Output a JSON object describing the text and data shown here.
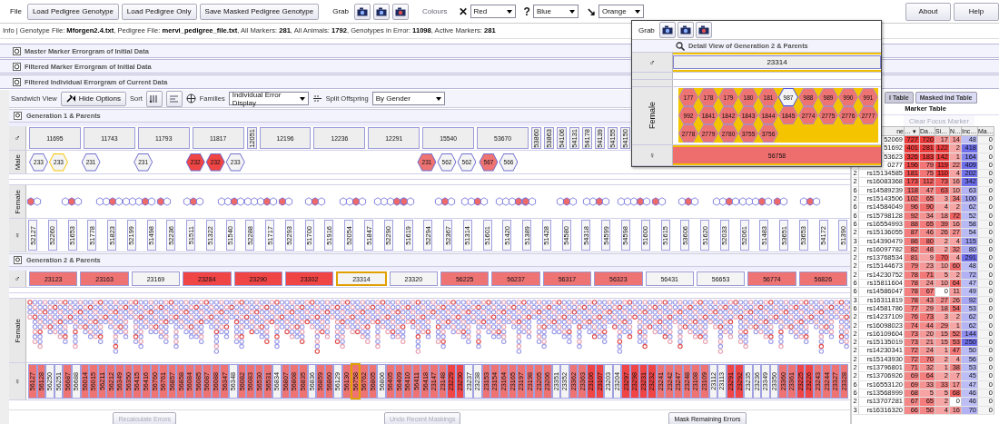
{
  "toolbar": {
    "file_label": "File",
    "buttons": [
      "Load Pedigree Genotype",
      "Load Pedigree Only",
      "Save Masked Pedigree Genotype"
    ],
    "grab_label": "Grab",
    "colours_label": "Colours",
    "colour_selects": [
      {
        "symbol": "✕",
        "value": "Red"
      },
      {
        "symbol": "?",
        "value": "Blue"
      },
      {
        "symbol": "↘",
        "value": "Orange"
      }
    ],
    "right_buttons": [
      "About",
      "Help"
    ]
  },
  "info": "Info | Genotype File: **Mforgen2.4.txt**, Pedigree File: **mervi_pedigree_file.txt**, All Markers: **281**, All Animals: **1792**, Genotypes in Error: **11098**, Active Markers: **281**",
  "sections": [
    "Master Marker Errorgram of Initial Data",
    "Filtered Marker Errorgram of Initial Data",
    "Filtered Individual Errorgram of Current Data"
  ],
  "options": {
    "label": "Sandwich View",
    "hide_button": "Hide Options",
    "sort_label": "Sort",
    "families_label": "Families",
    "families_value": "Individual Error Display",
    "split_label": "Split Offspring",
    "split_value": "By Gender"
  },
  "generation1": {
    "title": "Generation 1 & Parents",
    "father_symbol": "♂",
    "male_label": "Male",
    "female_label": "Female",
    "mother_symbol": "♀",
    "fathers": [
      {
        "label": "11695",
        "kind": "wide",
        "sons": [
          {
            "label": "233",
            "color": "#f4f4f4",
            "selected": false
          },
          {
            "label": "233",
            "color": "#f4f4f4",
            "selected": true
          }
        ]
      },
      {
        "label": "11743",
        "kind": "wide",
        "sons": [
          {
            "label": "231",
            "color": "#f4f4f4",
            "selected": false
          }
        ]
      },
      {
        "label": "11793",
        "kind": "wide",
        "sons": [
          {
            "label": "231",
            "color": "#f4f4f4",
            "selected": false
          }
        ]
      },
      {
        "label": "11817",
        "kind": "wide",
        "sons": [
          {
            "label": "232",
            "color": "#f04545",
            "selected": false
          },
          {
            "label": "232",
            "color": "#f04545",
            "selected": false
          },
          {
            "label": "233",
            "color": "#f4f4f4",
            "selected": false
          }
        ]
      },
      {
        "label": "12051",
        "kind": "narrow"
      },
      {
        "label": "12196",
        "kind": "wide"
      },
      {
        "label": "12236",
        "kind": "wide"
      },
      {
        "label": "12291",
        "kind": "wide"
      },
      {
        "label": "15540",
        "kind": "wide",
        "sons": [
          {
            "label": "231",
            "color": "#ee7373",
            "selected": false
          },
          {
            "label": "562",
            "color": "#f4f4f4",
            "selected": false
          },
          {
            "label": "562",
            "color": "#f4f4f4",
            "selected": false
          }
        ]
      },
      {
        "label": "53670",
        "kind": "wide",
        "sons": [
          {
            "label": "567",
            "color": "#ee7373",
            "selected": false
          },
          {
            "label": "566",
            "color": "#f4f4f4",
            "selected": false
          }
        ]
      },
      {
        "label": "53860",
        "kind": "narrow"
      },
      {
        "label": "53863",
        "kind": "narrow"
      },
      {
        "label": "54106",
        "kind": "narrow"
      },
      {
        "label": "54131",
        "kind": "narrow"
      },
      {
        "label": "54178",
        "kind": "narrow"
      },
      {
        "label": "54139",
        "kind": "narrow"
      },
      {
        "label": "54155",
        "kind": "narrow"
      },
      {
        "label": "54150",
        "kind": "narrow"
      }
    ],
    "offspring": [
      "52127",
      "52260",
      "51653",
      "51778",
      "51823",
      "52199",
      "51498",
      "52236",
      "51511",
      "51322",
      "51540",
      "52288",
      "51717",
      "52293",
      "51700",
      "51916",
      "52054",
      "51847",
      "52290",
      "51619",
      "52294",
      "52367",
      "51314",
      "51601",
      "51420",
      "51389",
      "51428",
      "54580",
      "54318",
      "54599",
      "54598",
      "51600",
      "51615",
      "53606",
      "51620",
      "52033",
      "52061",
      "51483",
      "53651",
      "53653",
      "54172",
      "51390"
    ]
  },
  "generation2": {
    "title": "Generation 2 & Parents",
    "father_symbol": "♂",
    "female_label": "Female",
    "mother_symbol": "♀",
    "fathers": [
      {
        "label": "23123",
        "color": "#ee7373",
        "selected": false
      },
      {
        "label": "23163",
        "color": "#ee7373",
        "selected": false
      },
      {
        "label": "23169",
        "color": "#f4f4f4",
        "selected": false
      },
      {
        "label": "23284",
        "color": "#f04545",
        "selected": false
      },
      {
        "label": "23290",
        "color": "#f04545",
        "selected": false
      },
      {
        "label": "23302",
        "color": "#f04545",
        "selected": false
      },
      {
        "label": "23314",
        "color": "#f4f4f4",
        "selected": true
      },
      {
        "label": "23320",
        "color": "#f4f4f4",
        "selected": false
      },
      {
        "label": "56225",
        "color": "#ee7373",
        "selected": false
      },
      {
        "label": "56237",
        "color": "#ee7373",
        "selected": false
      },
      {
        "label": "56317",
        "color": "#ee7373",
        "selected": false
      },
      {
        "label": "56323",
        "color": "#ee7373",
        "selected": false
      },
      {
        "label": "56431",
        "color": "#f4f4f4",
        "selected": false
      },
      {
        "label": "56653",
        "color": "#f4f4f4",
        "selected": false
      },
      {
        "label": "56774",
        "color": "#ee7373",
        "selected": false
      },
      {
        "label": "56826",
        "color": "#ee7373",
        "selected": false
      }
    ],
    "offspring": [
      {
        "label": "56127",
        "color": "#ee7373",
        "selected": false
      },
      {
        "label": "56128",
        "color": "#ee7373",
        "selected": false
      },
      {
        "label": "56250",
        "color": "#f4f4f4",
        "selected": false
      },
      {
        "label": "56251",
        "color": "#f4f4f4",
        "selected": false
      },
      {
        "label": "56687",
        "color": "#ee7373",
        "selected": false
      },
      {
        "label": "56688",
        "color": "#f4f4f4",
        "selected": false
      },
      {
        "label": "56014",
        "color": "#ee7373",
        "selected": false
      },
      {
        "label": "56015",
        "color": "#ee7373",
        "selected": false
      },
      {
        "label": "56211",
        "color": "#ee7373",
        "selected": false
      },
      {
        "label": "56212",
        "color": "#ee7373",
        "selected": false
      },
      {
        "label": "56349",
        "color": "#ee7373",
        "selected": false
      },
      {
        "label": "56350",
        "color": "#ee7373",
        "selected": false
      },
      {
        "label": "56415",
        "color": "#ee7373",
        "selected": false
      },
      {
        "label": "56416",
        "color": "#ee7373",
        "selected": false
      },
      {
        "label": "56760",
        "color": "#ee7373",
        "selected": false
      },
      {
        "label": "56761",
        "color": "#ee7373",
        "selected": false
      },
      {
        "label": "56857",
        "color": "#ee7373",
        "selected": false
      },
      {
        "label": "56858",
        "color": "#ee7373",
        "selected": false
      },
      {
        "label": "56084",
        "color": "#ee7373",
        "selected": false
      },
      {
        "label": "56085",
        "color": "#ee7373",
        "selected": false
      },
      {
        "label": "56087",
        "color": "#ee7373",
        "selected": false
      },
      {
        "label": "56088",
        "color": "#ee7373",
        "selected": false
      },
      {
        "label": "56347",
        "color": "#ee7373",
        "selected": false
      },
      {
        "label": "56348",
        "color": "#f4f4f4",
        "selected": false
      },
      {
        "label": "56082",
        "color": "#ee7373",
        "selected": false
      },
      {
        "label": "56083",
        "color": "#ee7373",
        "selected": false
      },
      {
        "label": "56530",
        "color": "#ee7373",
        "selected": false
      },
      {
        "label": "56531",
        "color": "#ee7373",
        "selected": false
      },
      {
        "label": "56834",
        "color": "#f4f4f4",
        "selected": false
      },
      {
        "label": "56807",
        "color": "#ee7373",
        "selected": false
      },
      {
        "label": "56808",
        "color": "#ee7373",
        "selected": false
      },
      {
        "label": "56835",
        "color": "#ee7373",
        "selected": false
      },
      {
        "label": "56836",
        "color": "#f4f4f4",
        "selected": false
      },
      {
        "label": "56859",
        "color": "#ee7373",
        "selected": false
      },
      {
        "label": "56860",
        "color": "#ee7373",
        "selected": false
      },
      {
        "label": "56129",
        "color": "#f4f4f4",
        "selected": false
      },
      {
        "label": "56130",
        "color": "#ee7373",
        "selected": false
      },
      {
        "label": "56758",
        "color": "#ee7373",
        "selected": true
      },
      {
        "label": "56762",
        "color": "#ee7373",
        "selected": false
      },
      {
        "label": "56805",
        "color": "#ee7373",
        "selected": false
      },
      {
        "label": "56806",
        "color": "#f4f4f4",
        "selected": false
      },
      {
        "label": "56405",
        "color": "#ee7373",
        "selected": false
      },
      {
        "label": "56409",
        "color": "#ee7373",
        "selected": false
      },
      {
        "label": "56410",
        "color": "#ee7373",
        "selected": false
      },
      {
        "label": "56411",
        "color": "#ee7373",
        "selected": false
      },
      {
        "label": "56418",
        "color": "#ee7373",
        "selected": false
      },
      {
        "label": "23147",
        "color": "#ee7373",
        "selected": false
      },
      {
        "label": "23148",
        "color": "#ee7373",
        "selected": false
      },
      {
        "label": "23229",
        "color": "#f04545",
        "selected": false
      },
      {
        "label": "23230",
        "color": "#f04545",
        "selected": false
      },
      {
        "label": "23237",
        "color": "#f4f4f4",
        "selected": false
      },
      {
        "label": "23238",
        "color": "#f4f4f4",
        "selected": false
      },
      {
        "label": "23153",
        "color": "#ee7373",
        "selected": false
      },
      {
        "label": "23154",
        "color": "#ee7373",
        "selected": false
      },
      {
        "label": "23164",
        "color": "#ee7373",
        "selected": false
      },
      {
        "label": "23165",
        "color": "#ee7373",
        "selected": false
      },
      {
        "label": "23197",
        "color": "#ee7373",
        "selected": false
      },
      {
        "label": "23198",
        "color": "#ee7373",
        "selected": false
      },
      {
        "label": "23205",
        "color": "#ee7373",
        "selected": false
      },
      {
        "label": "23206",
        "color": "#ee7373",
        "selected": false
      },
      {
        "label": "23351",
        "color": "#f4f4f4",
        "selected": false
      },
      {
        "label": "23352",
        "color": "#f4f4f4",
        "selected": false
      },
      {
        "label": "23362",
        "color": "#ee7373",
        "selected": false
      },
      {
        "label": "23363",
        "color": "#ee7373",
        "selected": false
      },
      {
        "label": "23106",
        "color": "#f04545",
        "selected": false
      },
      {
        "label": "23107",
        "color": "#f04545",
        "selected": false
      },
      {
        "label": "23203",
        "color": "#f4f4f4",
        "selected": false
      },
      {
        "label": "23204",
        "color": "#f4f4f4",
        "selected": false
      },
      {
        "label": "23297",
        "color": "#f04545",
        "selected": false
      },
      {
        "label": "23298",
        "color": "#f04545",
        "selected": false
      },
      {
        "label": "23231",
        "color": "#f04545",
        "selected": false
      },
      {
        "label": "23232",
        "color": "#f04545",
        "selected": false
      },
      {
        "label": "23241",
        "color": "#ee7373",
        "selected": false
      },
      {
        "label": "23242",
        "color": "#ee7373",
        "selected": false
      },
      {
        "label": "23247",
        "color": "#ee7373",
        "selected": false
      },
      {
        "label": "23248",
        "color": "#ee7373",
        "selected": false
      },
      {
        "label": "23108",
        "color": "#ee7373",
        "selected": false
      },
      {
        "label": "23109",
        "color": "#ee7373",
        "selected": false
      },
      {
        "label": "23112",
        "color": "#f4f4f4",
        "selected": false
      },
      {
        "label": "23113",
        "color": "#f4f4f4",
        "selected": false
      },
      {
        "label": "23291",
        "color": "#f04545",
        "selected": false
      },
      {
        "label": "23292",
        "color": "#f04545",
        "selected": false
      },
      {
        "label": "23235",
        "color": "#f4f4f4",
        "selected": false
      },
      {
        "label": "23236",
        "color": "#f4f4f4",
        "selected": false
      },
      {
        "label": "23349",
        "color": "#f4f4f4",
        "selected": false
      },
      {
        "label": "23350",
        "color": "#f4f4f4",
        "selected": false
      },
      {
        "label": "23360",
        "color": "#ee7373",
        "selected": false
      },
      {
        "label": "23361",
        "color": "#ee7373",
        "selected": false
      },
      {
        "label": "23225",
        "color": "#f04545",
        "selected": false
      },
      {
        "label": "23226",
        "color": "#f04545",
        "selected": false
      },
      {
        "label": "23243",
        "color": "#ee7373",
        "selected": false
      },
      {
        "label": "23244",
        "color": "#ee7373",
        "selected": false
      },
      {
        "label": "23327",
        "color": "#ee7373",
        "selected": false
      },
      {
        "label": "23328",
        "color": "#ee7373",
        "selected": false
      }
    ]
  },
  "bottom_buttons": [
    {
      "label": "Recalculate Errors",
      "disabled": true
    },
    {
      "label": "Undo Recent Maskings",
      "disabled": true
    },
    {
      "label": "Mask Remaining Errors",
      "disabled": false
    }
  ],
  "detail_popup": {
    "grab_label": "Grab",
    "title": "Detail View of Generation 2 & Parents",
    "father_symbol": "♂",
    "father": "23314",
    "female_label": "Female",
    "mother_symbol": "♀",
    "mother": "56758",
    "daughters": [
      {
        "label": "177",
        "color": "#ee7373"
      },
      {
        "label": "178",
        "color": "#ee7373"
      },
      {
        "label": "179",
        "color": "#ee7373"
      },
      {
        "label": "180",
        "color": "#ee7373"
      },
      {
        "label": "181",
        "color": "#ee7373"
      },
      {
        "label": "987",
        "color": "#f4f4f4"
      },
      {
        "label": "988",
        "color": "#ee7373"
      },
      {
        "label": "989",
        "color": "#ee7373"
      },
      {
        "label": "990",
        "color": "#ee7373"
      },
      {
        "label": "991",
        "color": "#ee7373"
      },
      {
        "label": "992",
        "color": "#ee7373"
      },
      {
        "label": "1841",
        "color": "#ee7373"
      },
      {
        "label": "1842",
        "color": "#ee7373"
      },
      {
        "label": "1843",
        "color": "#ee7373"
      },
      {
        "label": "1844",
        "color": "#ee7373"
      },
      {
        "label": "1845",
        "color": "#ee7373"
      },
      {
        "label": "2774",
        "color": "#ee7373"
      },
      {
        "label": "2775",
        "color": "#ee7373"
      },
      {
        "label": "2776",
        "color": "#ee7373"
      },
      {
        "label": "2777",
        "color": "#ee7373"
      },
      {
        "label": "2778",
        "color": "#ee7373"
      },
      {
        "label": "2779",
        "color": "#ee7373"
      },
      {
        "label": "2780",
        "color": "#ee7373"
      },
      {
        "label": "3755",
        "color": "#ee7373"
      },
      {
        "label": "3756",
        "color": "#ee7373"
      }
    ]
  },
  "marker_panel": {
    "tabs": [
      {
        "label": "l Table",
        "selected": false
      },
      {
        "label": "Masked Ind Table",
        "selected": true
      }
    ],
    "title": "Marker Table",
    "clear_button": {
      "label": "Clear Focus Marker",
      "disabled": true
    },
    "name_column": "ne",
    "value_columns": [
      "… ▾",
      "Da…",
      "Si…",
      "N…",
      "Inc…",
      "Ma…"
    ],
    "rows": [
      {
        "name": "52069",
        "values": [
          "727",
          "720",
          "17",
          "14",
          "48",
          "0"
        ]
      },
      {
        "name": "51692",
        "values": [
          "401",
          "281",
          "122",
          "2",
          "418",
          "0"
        ]
      },
      {
        "name": "53623",
        "values": [
          "326",
          "183",
          "142",
          "1",
          "164",
          "0"
        ]
      },
      {
        "name": "0277",
        "values": [
          "196",
          "79",
          "119",
          "22",
          "409",
          "0"
        ]
      },
      {
        "chr": "2",
        "name": "rs15134585",
        "values": [
          "181",
          "75",
          "110",
          "4",
          "202",
          "0"
        ]
      },
      {
        "chr": "2",
        "name": "rs16083368",
        "values": [
          "173",
          "112",
          "73",
          "16",
          "342",
          "0"
        ]
      },
      {
        "chr": "6",
        "name": "rs14589239",
        "values": [
          "118",
          "47",
          "63",
          "10",
          "63",
          "0"
        ]
      },
      {
        "chr": "2",
        "name": "rs15143506",
        "values": [
          "102",
          "65",
          "3",
          "34",
          "100",
          "0"
        ]
      },
      {
        "chr": "6",
        "name": "rs14584049",
        "values": [
          "96",
          "90",
          "4",
          "2",
          "62",
          "0"
        ]
      },
      {
        "chr": "6",
        "name": "rs15798128",
        "values": [
          "92",
          "34",
          "18",
          "72",
          "52",
          "0"
        ]
      },
      {
        "chr": "6",
        "name": "rs16554993",
        "values": [
          "88",
          "65",
          "39",
          "16",
          "58",
          "0"
        ]
      },
      {
        "chr": "2",
        "name": "rs15136055",
        "values": [
          "87",
          "46",
          "26",
          "27",
          "54",
          "0"
        ]
      },
      {
        "chr": "3",
        "name": "rs14390479",
        "values": [
          "86",
          "80",
          "2",
          "4",
          "115",
          "0"
        ]
      },
      {
        "chr": "2",
        "name": "rs16097782",
        "values": [
          "82",
          "48",
          "2",
          "32",
          "80",
          "0"
        ]
      },
      {
        "chr": "2",
        "name": "rs13768534",
        "values": [
          "81",
          "9",
          "70",
          "4",
          "291",
          "0"
        ]
      },
      {
        "chr": "2",
        "name": "rs15144673",
        "values": [
          "79",
          "23",
          "10",
          "60",
          "48",
          "0"
        ]
      },
      {
        "chr": "2",
        "name": "rs14230752",
        "values": [
          "78",
          "71",
          "5",
          "2",
          "72",
          "0"
        ]
      },
      {
        "chr": "6",
        "name": "rs15811604",
        "values": [
          "78",
          "24",
          "10",
          "64",
          "47",
          "0"
        ]
      },
      {
        "chr": "6",
        "name": "rs14586047",
        "values": [
          "78",
          "67",
          "0",
          "11",
          "49",
          "0"
        ]
      },
      {
        "chr": "3",
        "name": "rs16311819",
        "values": [
          "78",
          "43",
          "27",
          "26",
          "92",
          "0"
        ]
      },
      {
        "chr": "6",
        "name": "rs14581786",
        "values": [
          "77",
          "29",
          "18",
          "54",
          "53",
          "0"
        ]
      },
      {
        "chr": "2",
        "name": "rs14237109",
        "values": [
          "76",
          "73",
          "3",
          "2",
          "62",
          "0"
        ]
      },
      {
        "chr": "2",
        "name": "rs16098023",
        "values": [
          "74",
          "44",
          "29",
          "1",
          "62",
          "0"
        ]
      },
      {
        "chr": "2",
        "name": "rs16109604",
        "values": [
          "73",
          "20",
          "15",
          "52",
          "144",
          "0"
        ]
      },
      {
        "chr": "2",
        "name": "rs15135019",
        "values": [
          "73",
          "21",
          "15",
          "53",
          "250",
          "0"
        ]
      },
      {
        "chr": "2",
        "name": "rs14230341",
        "values": [
          "72",
          "24",
          "1",
          "47",
          "50",
          "0"
        ]
      },
      {
        "chr": "2",
        "name": "rs15143930",
        "values": [
          "72",
          "70",
          "2",
          "4",
          "56",
          "0"
        ]
      },
      {
        "chr": "2",
        "name": "rs13796801",
        "values": [
          "71",
          "32",
          "1",
          "38",
          "53",
          "0"
        ]
      },
      {
        "chr": "2",
        "name": "rs13706926",
        "values": [
          "69",
          "64",
          "2",
          "7",
          "45",
          "0"
        ]
      },
      {
        "chr": "6",
        "name": "rs16553120",
        "values": [
          "69",
          "33",
          "33",
          "17",
          "47",
          "0"
        ]
      },
      {
        "chr": "6",
        "name": "rs13568999",
        "values": [
          "68",
          "5",
          "5",
          "68",
          "46",
          "0"
        ]
      },
      {
        "chr": "2",
        "name": "rs13707281",
        "values": [
          "67",
          "65",
          "2",
          "0",
          "46",
          "0"
        ]
      },
      {
        "chr": "3",
        "name": "rs16316320",
        "values": [
          "66",
          "50",
          "4",
          "16",
          "70",
          "0"
        ]
      }
    ]
  }
}
